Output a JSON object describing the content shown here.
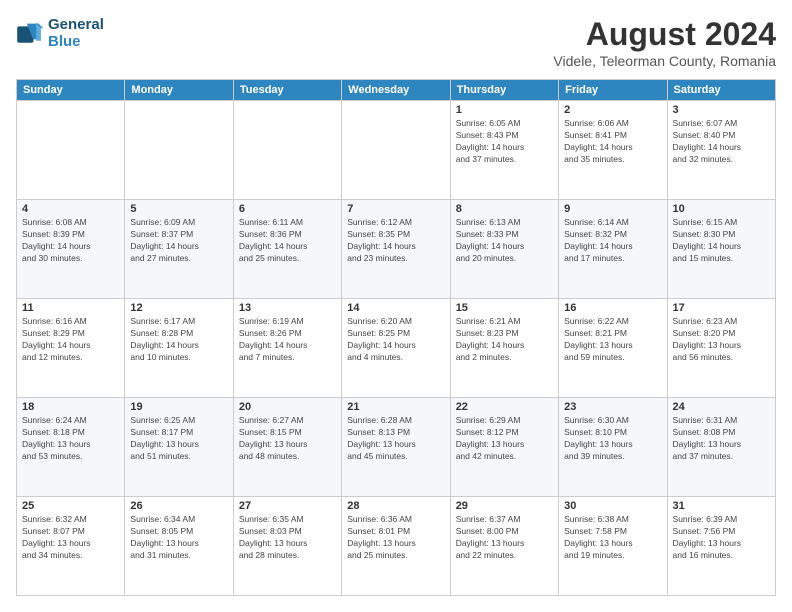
{
  "logo": {
    "line1": "General",
    "line2": "Blue"
  },
  "title": "August 2024",
  "location": "Videle, Teleorman County, Romania",
  "days_of_week": [
    "Sunday",
    "Monday",
    "Tuesday",
    "Wednesday",
    "Thursday",
    "Friday",
    "Saturday"
  ],
  "weeks": [
    [
      {
        "day": "",
        "info": ""
      },
      {
        "day": "",
        "info": ""
      },
      {
        "day": "",
        "info": ""
      },
      {
        "day": "",
        "info": ""
      },
      {
        "day": "1",
        "info": "Sunrise: 6:05 AM\nSunset: 8:43 PM\nDaylight: 14 hours\nand 37 minutes."
      },
      {
        "day": "2",
        "info": "Sunrise: 6:06 AM\nSunset: 8:41 PM\nDaylight: 14 hours\nand 35 minutes."
      },
      {
        "day": "3",
        "info": "Sunrise: 6:07 AM\nSunset: 8:40 PM\nDaylight: 14 hours\nand 32 minutes."
      }
    ],
    [
      {
        "day": "4",
        "info": "Sunrise: 6:08 AM\nSunset: 8:39 PM\nDaylight: 14 hours\nand 30 minutes."
      },
      {
        "day": "5",
        "info": "Sunrise: 6:09 AM\nSunset: 8:37 PM\nDaylight: 14 hours\nand 27 minutes."
      },
      {
        "day": "6",
        "info": "Sunrise: 6:11 AM\nSunset: 8:36 PM\nDaylight: 14 hours\nand 25 minutes."
      },
      {
        "day": "7",
        "info": "Sunrise: 6:12 AM\nSunset: 8:35 PM\nDaylight: 14 hours\nand 23 minutes."
      },
      {
        "day": "8",
        "info": "Sunrise: 6:13 AM\nSunset: 8:33 PM\nDaylight: 14 hours\nand 20 minutes."
      },
      {
        "day": "9",
        "info": "Sunrise: 6:14 AM\nSunset: 8:32 PM\nDaylight: 14 hours\nand 17 minutes."
      },
      {
        "day": "10",
        "info": "Sunrise: 6:15 AM\nSunset: 8:30 PM\nDaylight: 14 hours\nand 15 minutes."
      }
    ],
    [
      {
        "day": "11",
        "info": "Sunrise: 6:16 AM\nSunset: 8:29 PM\nDaylight: 14 hours\nand 12 minutes."
      },
      {
        "day": "12",
        "info": "Sunrise: 6:17 AM\nSunset: 8:28 PM\nDaylight: 14 hours\nand 10 minutes."
      },
      {
        "day": "13",
        "info": "Sunrise: 6:19 AM\nSunset: 8:26 PM\nDaylight: 14 hours\nand 7 minutes."
      },
      {
        "day": "14",
        "info": "Sunrise: 6:20 AM\nSunset: 8:25 PM\nDaylight: 14 hours\nand 4 minutes."
      },
      {
        "day": "15",
        "info": "Sunrise: 6:21 AM\nSunset: 8:23 PM\nDaylight: 14 hours\nand 2 minutes."
      },
      {
        "day": "16",
        "info": "Sunrise: 6:22 AM\nSunset: 8:21 PM\nDaylight: 13 hours\nand 59 minutes."
      },
      {
        "day": "17",
        "info": "Sunrise: 6:23 AM\nSunset: 8:20 PM\nDaylight: 13 hours\nand 56 minutes."
      }
    ],
    [
      {
        "day": "18",
        "info": "Sunrise: 6:24 AM\nSunset: 8:18 PM\nDaylight: 13 hours\nand 53 minutes."
      },
      {
        "day": "19",
        "info": "Sunrise: 6:25 AM\nSunset: 8:17 PM\nDaylight: 13 hours\nand 51 minutes."
      },
      {
        "day": "20",
        "info": "Sunrise: 6:27 AM\nSunset: 8:15 PM\nDaylight: 13 hours\nand 48 minutes."
      },
      {
        "day": "21",
        "info": "Sunrise: 6:28 AM\nSunset: 8:13 PM\nDaylight: 13 hours\nand 45 minutes."
      },
      {
        "day": "22",
        "info": "Sunrise: 6:29 AM\nSunset: 8:12 PM\nDaylight: 13 hours\nand 42 minutes."
      },
      {
        "day": "23",
        "info": "Sunrise: 6:30 AM\nSunset: 8:10 PM\nDaylight: 13 hours\nand 39 minutes."
      },
      {
        "day": "24",
        "info": "Sunrise: 6:31 AM\nSunset: 8:08 PM\nDaylight: 13 hours\nand 37 minutes."
      }
    ],
    [
      {
        "day": "25",
        "info": "Sunrise: 6:32 AM\nSunset: 8:07 PM\nDaylight: 13 hours\nand 34 minutes."
      },
      {
        "day": "26",
        "info": "Sunrise: 6:34 AM\nSunset: 8:05 PM\nDaylight: 13 hours\nand 31 minutes."
      },
      {
        "day": "27",
        "info": "Sunrise: 6:35 AM\nSunset: 8:03 PM\nDaylight: 13 hours\nand 28 minutes."
      },
      {
        "day": "28",
        "info": "Sunrise: 6:36 AM\nSunset: 8:01 PM\nDaylight: 13 hours\nand 25 minutes."
      },
      {
        "day": "29",
        "info": "Sunrise: 6:37 AM\nSunset: 8:00 PM\nDaylight: 13 hours\nand 22 minutes."
      },
      {
        "day": "30",
        "info": "Sunrise: 6:38 AM\nSunset: 7:58 PM\nDaylight: 13 hours\nand 19 minutes."
      },
      {
        "day": "31",
        "info": "Sunrise: 6:39 AM\nSunset: 7:56 PM\nDaylight: 13 hours\nand 16 minutes."
      }
    ]
  ]
}
